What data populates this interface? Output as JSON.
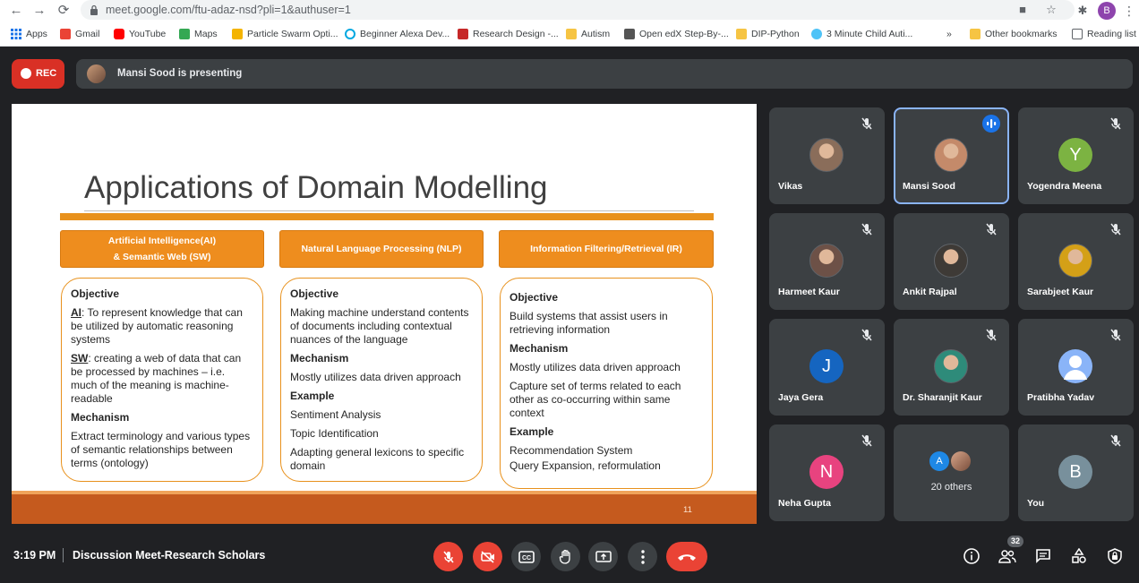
{
  "browser": {
    "url": "meet.google.com/ftu-adaz-nsd?pli=1&authuser=1",
    "profile_initial": "B",
    "bookmarks": [
      {
        "label": "Apps"
      },
      {
        "label": "Gmail"
      },
      {
        "label": "YouTube"
      },
      {
        "label": "Maps"
      },
      {
        "label": "Particle Swarm Opti..."
      },
      {
        "label": "Beginner Alexa Dev..."
      },
      {
        "label": "Research Design -..."
      },
      {
        "label": "Autism"
      },
      {
        "label": "Open edX Step-By-..."
      },
      {
        "label": "DIP-Python"
      },
      {
        "label": "3 Minute Child Auti..."
      },
      {
        "label": "»"
      },
      {
        "label": "Other bookmarks"
      },
      {
        "label": "Reading list"
      }
    ]
  },
  "meet": {
    "rec_label": "REC",
    "presenting_text": "Mansi Sood is presenting",
    "time": "3:19 PM",
    "meeting_title": "Discussion Meet-Research Scholars",
    "people_count": "32"
  },
  "slide": {
    "title": "Applications of Domain Modelling",
    "page": "11",
    "columns": [
      {
        "header_line1": "Artificial Intelligence(AI)",
        "header_line2": "& Semantic Web (SW)",
        "objective_heading": "Objective",
        "ai_label": "AI",
        "ai_text": ": To represent knowledge that can be utilized by automatic reasoning systems",
        "sw_label": "SW",
        "sw_text": ": creating a web of data that can be processed by machines – i.e. much of the meaning is machine-readable",
        "mechanism_heading": "Mechanism",
        "mechanism_text": "Extract terminology and various types of semantic relationships between terms (ontology)"
      },
      {
        "header": "Natural Language Processing (NLP)",
        "objective_heading": "Objective",
        "objective_text": "Making machine understand contents of documents including contextual nuances of the language",
        "mechanism_heading": "Mechanism",
        "mechanism_text": "Mostly utilizes data driven approach",
        "example_heading": "Example",
        "examples": [
          "Sentiment Analysis",
          "Topic Identification",
          "Adapting general lexicons to specific domain"
        ]
      },
      {
        "header": "Information Filtering/Retrieval (IR)",
        "objective_heading": "Objective",
        "objective_text": "Build systems that assist users in retrieving information",
        "mechanism_heading": "Mechanism",
        "mechanism_text1": "Mostly utilizes data driven approach",
        "mechanism_text2": "Capture set of terms related to each other as co-occurring within same context",
        "example_heading": "Example",
        "examples": [
          "Recommendation System",
          "Query Expansion, reformulation"
        ]
      }
    ]
  },
  "participants": [
    {
      "name": "Vikas",
      "muted": true,
      "avatar": "photo",
      "color": "#8a6d5a"
    },
    {
      "name": "Mansi Sood",
      "muted": false,
      "speaking": true,
      "avatar": "photo",
      "color": "#c48a6a"
    },
    {
      "name": "Yogendra Meena",
      "muted": true,
      "avatar": "Y",
      "color": "#7cb342"
    },
    {
      "name": "Harmeet Kaur",
      "muted": true,
      "avatar": "photo",
      "color": "#6d5147"
    },
    {
      "name": "Ankit Rajpal",
      "muted": true,
      "avatar": "photo",
      "color": "#3e3a36"
    },
    {
      "name": "Sarabjeet Kaur",
      "muted": true,
      "avatar": "photo",
      "color": "#d4a017"
    },
    {
      "name": "Jaya Gera",
      "muted": true,
      "avatar": "J",
      "color": "#1565c0"
    },
    {
      "name": "Dr. Sharanjit Kaur",
      "muted": true,
      "avatar": "photo",
      "color": "#2e8b7a"
    },
    {
      "name": "Pratibha Yadav",
      "muted": true,
      "avatar": "person",
      "color": "#8ab4f8"
    },
    {
      "name": "Neha Gupta",
      "muted": true,
      "avatar": "N",
      "color": "#e8437f"
    },
    {
      "name": "You",
      "muted": true,
      "avatar": "B",
      "color": "#78909c"
    }
  ],
  "others": {
    "label": "20 others",
    "avatar_initial": "A"
  },
  "colors": {
    "accent_orange": "#ee8d1e",
    "slide_footer": "#c55a1e",
    "red": "#ea4335",
    "tile_bg": "#3c4043",
    "page_bg": "#202124"
  }
}
